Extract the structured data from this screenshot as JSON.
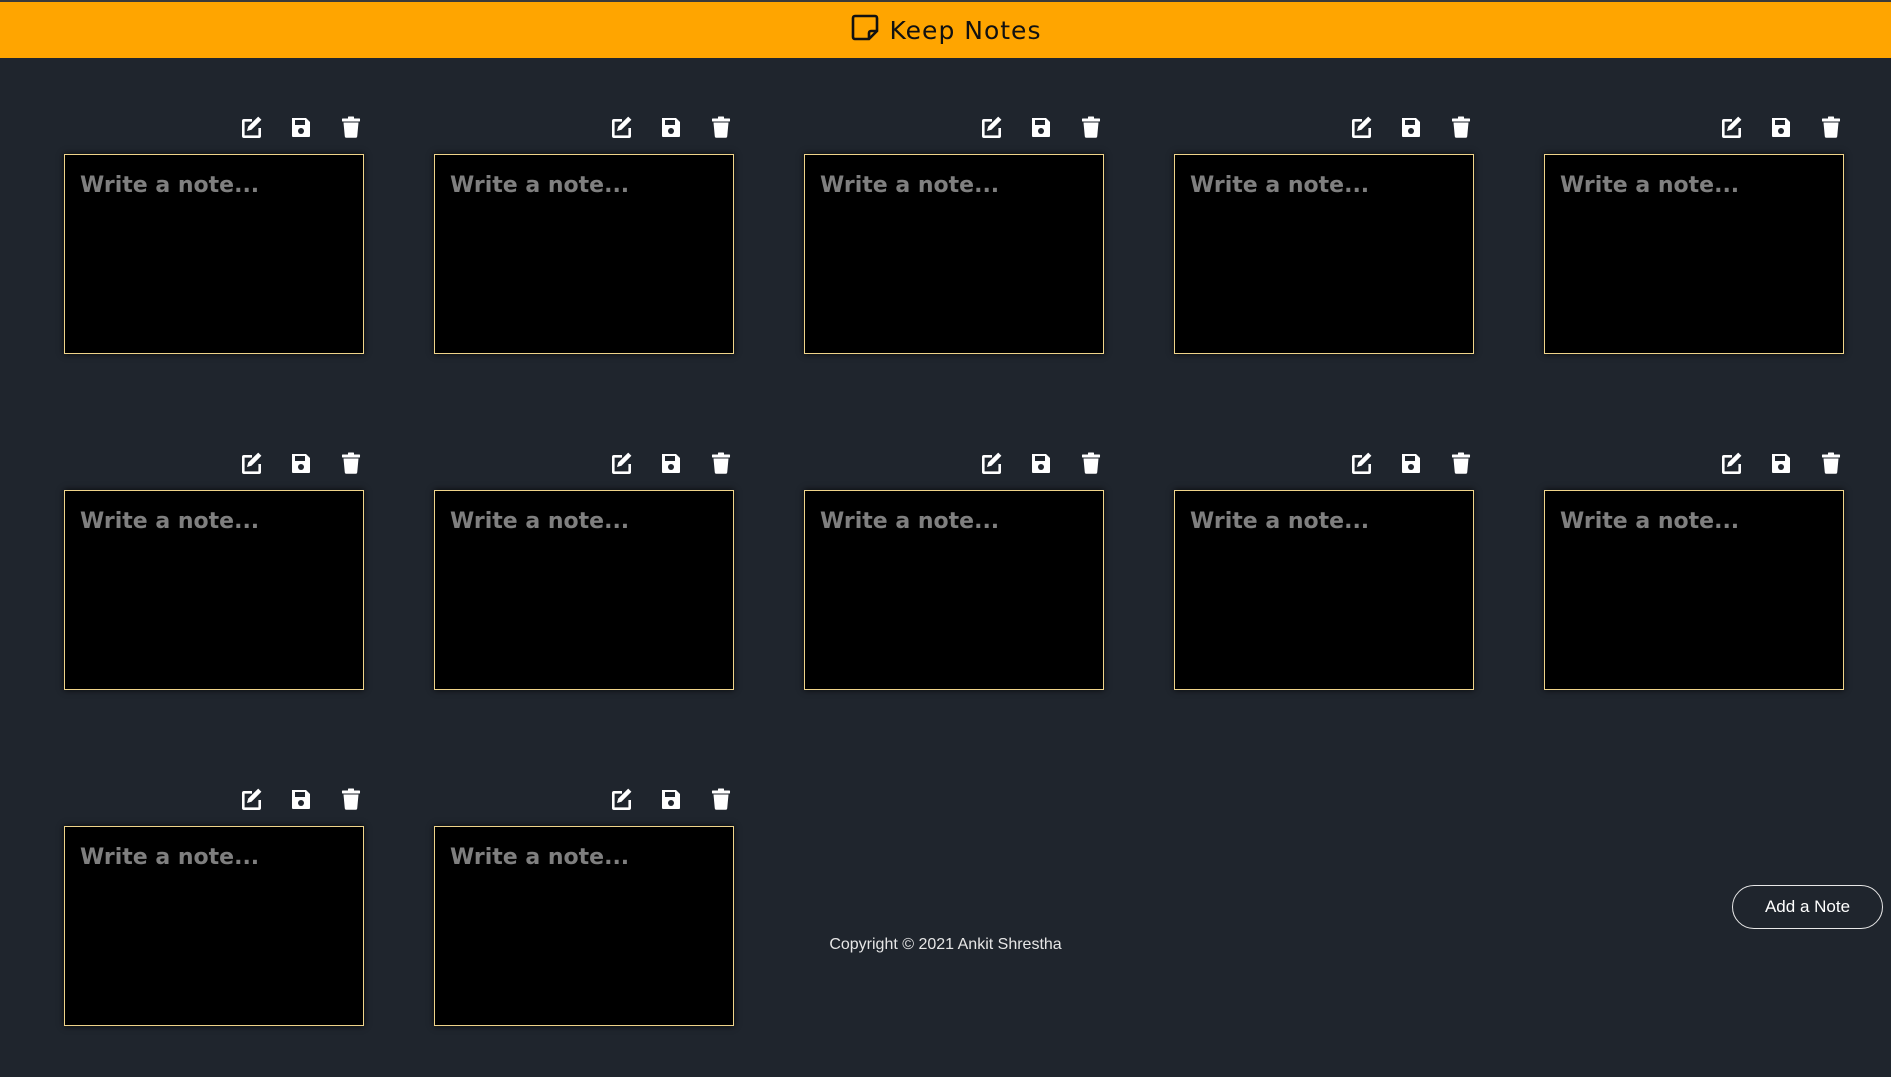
{
  "header": {
    "title": "Keep Notes",
    "icon": "note-icon",
    "background_color": "#ffa500"
  },
  "notes": {
    "placeholder": "Write a note...",
    "items": [
      {
        "id": 1
      },
      {
        "id": 2
      },
      {
        "id": 3
      },
      {
        "id": 4
      },
      {
        "id": 5
      },
      {
        "id": 6
      },
      {
        "id": 7
      },
      {
        "id": 8
      },
      {
        "id": 9
      },
      {
        "id": 10
      },
      {
        "id": 11
      },
      {
        "id": 12
      }
    ],
    "tool_icons": [
      "edit-icon",
      "save-icon",
      "trash-icon"
    ],
    "border_color": "#f0d48a"
  },
  "actions": {
    "add_note_label": "Add a Note"
  },
  "footer": {
    "copyright": "Copyright © 2021 Ankit Shrestha"
  }
}
